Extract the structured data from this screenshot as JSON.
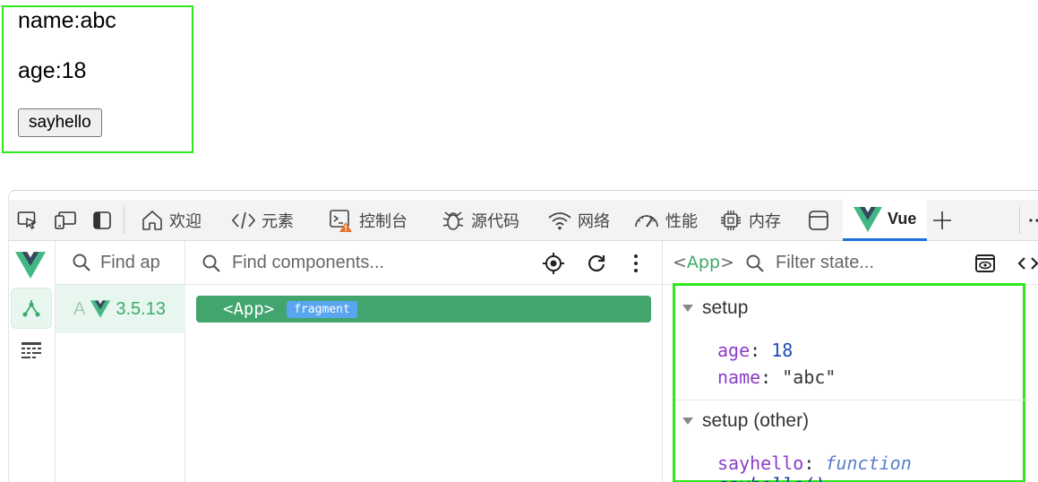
{
  "preview": {
    "name_line": "name:abc",
    "age_line": "age:18",
    "button_label": "sayhello"
  },
  "devtools": {
    "tabs": [
      {
        "label": "欢迎",
        "icon": "home-icon"
      },
      {
        "label": "元素",
        "icon": "code-icon"
      },
      {
        "label": "控制台",
        "icon": "console-icon"
      },
      {
        "label": "源代码",
        "icon": "bug-icon"
      },
      {
        "label": "网络",
        "icon": "wifi-icon"
      },
      {
        "label": "性能",
        "icon": "gauge-icon"
      },
      {
        "label": "内存",
        "icon": "chip-icon"
      },
      {
        "label": "Vue",
        "icon": "vue-logo-icon"
      }
    ],
    "active_tab": "Vue"
  },
  "vue": {
    "apps_search_placeholder": "Find ap",
    "app_item_prefix": "A",
    "app_version": "3.5.13",
    "tree_search_placeholder": "Find components...",
    "tree_root": {
      "name": "<App>",
      "badge": "fragment"
    },
    "state_component_open": "<",
    "state_component_name": "App",
    "state_component_close": ">",
    "state_search_placeholder": "Filter state...",
    "sections": [
      {
        "title": "setup",
        "entries": [
          {
            "key": "age",
            "value": "18"
          },
          {
            "key": "name",
            "value": "\"abc\""
          }
        ]
      },
      {
        "title": "setup (other)",
        "entries": [
          {
            "key": "sayhello",
            "value_keyword": "function",
            "value_name": "sayhello()"
          }
        ]
      }
    ],
    "colors": {
      "vue_green": "#41a56d",
      "highlight_border": "#2ee81d",
      "badge_blue": "#5aa5f0"
    }
  }
}
